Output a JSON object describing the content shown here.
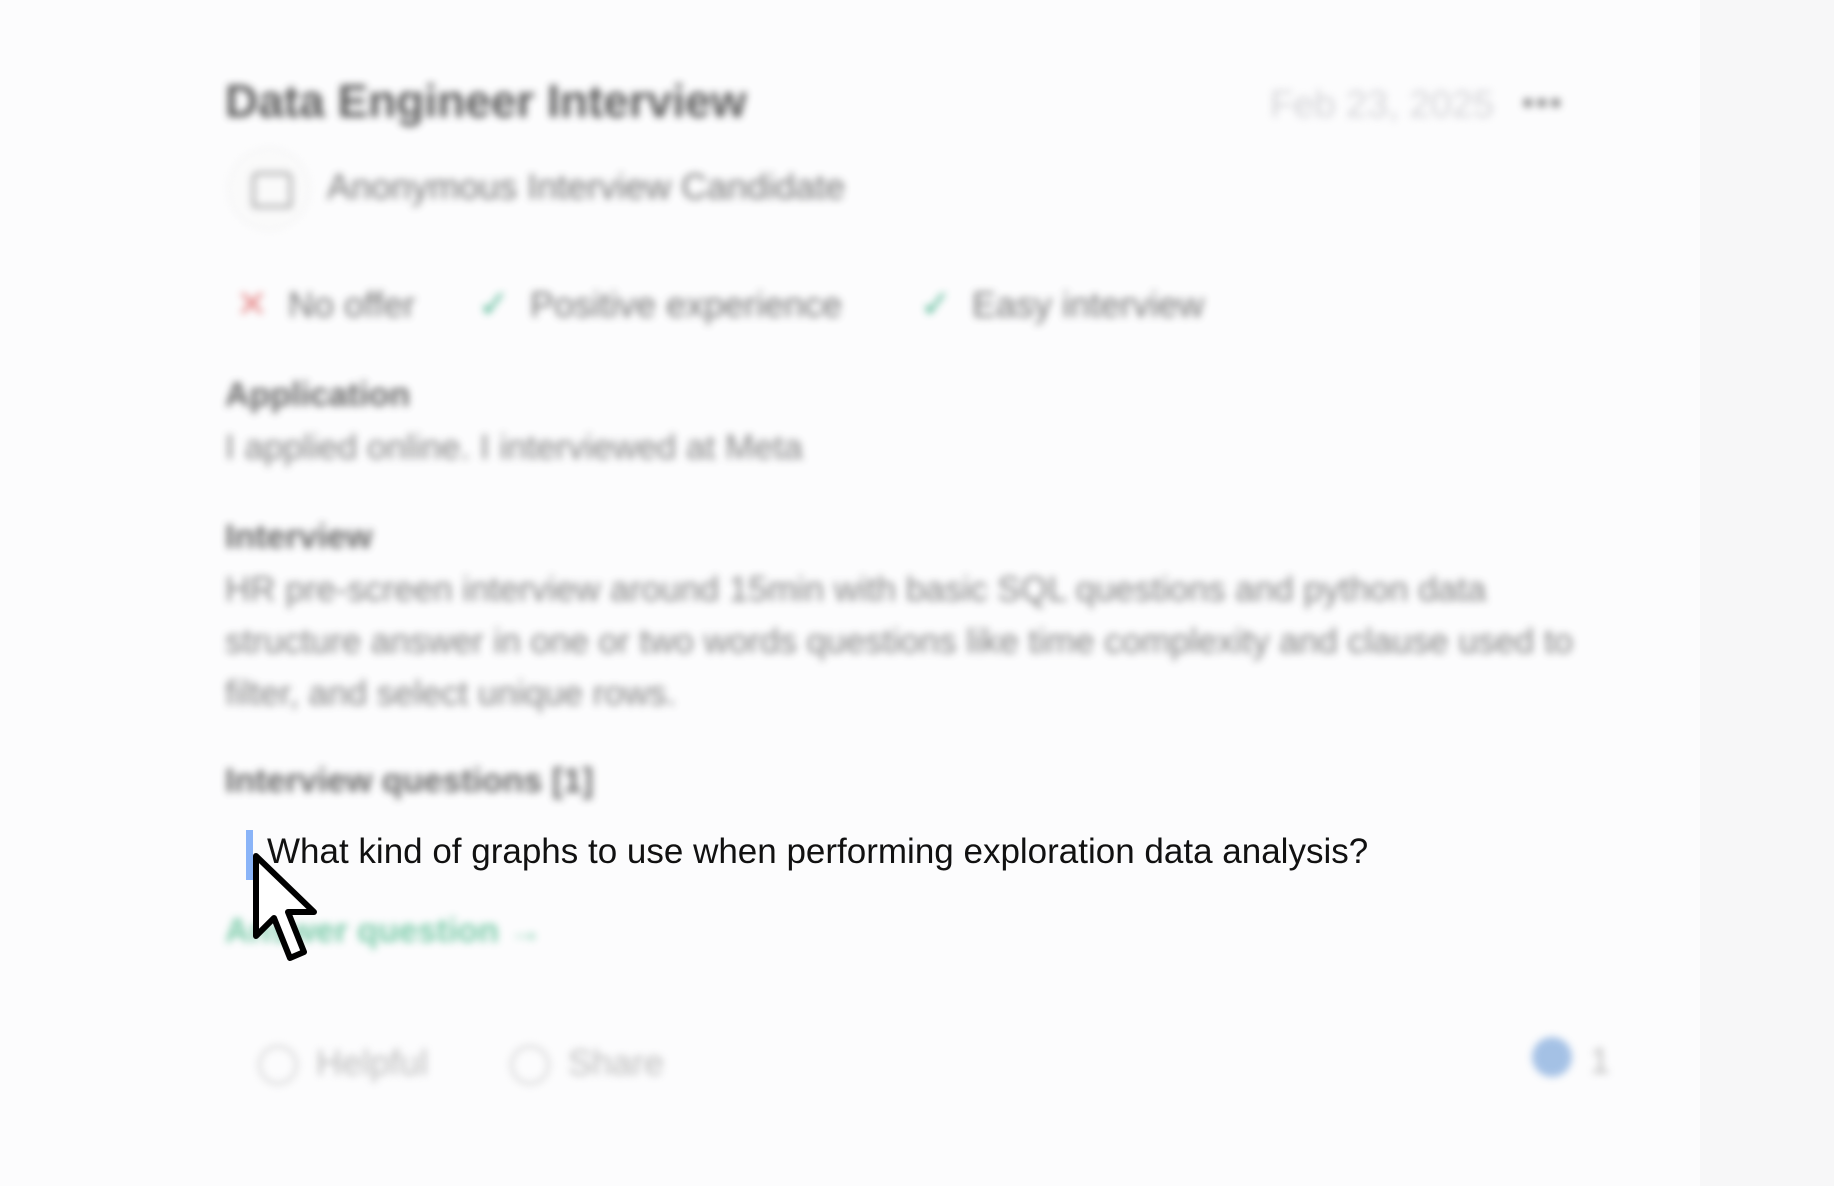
{
  "review": {
    "title": "Data Engineer Interview",
    "date": "Feb 23, 2025",
    "more_label": "•••",
    "author": "Anonymous Interview Candidate"
  },
  "badges": [
    {
      "icon": "x-icon",
      "label": "No offer"
    },
    {
      "icon": "check-icon",
      "label": "Positive experience"
    },
    {
      "icon": "check-icon",
      "label": "Easy interview"
    }
  ],
  "application": {
    "heading": "Application",
    "body": "I applied online. I interviewed at Meta"
  },
  "interview": {
    "heading": "Interview",
    "body": "HR pre-screen interview around 15min with basic SQL questions and python data structure answer in one or two words questions like time complexity and clause used to filter, and select unique rows."
  },
  "questions": {
    "heading": "Interview questions [1]",
    "items": [
      "What kind of graphs to use when performing exploration data analysis?"
    ],
    "answer_link": "Answer question →"
  },
  "footer": {
    "helpful": "Helpful",
    "share": "Share",
    "helpful_count": "1"
  },
  "colors": {
    "accent_green": "#2aa67a",
    "error_red": "#e06a6a",
    "caret_blue": "#8ab4f8"
  }
}
